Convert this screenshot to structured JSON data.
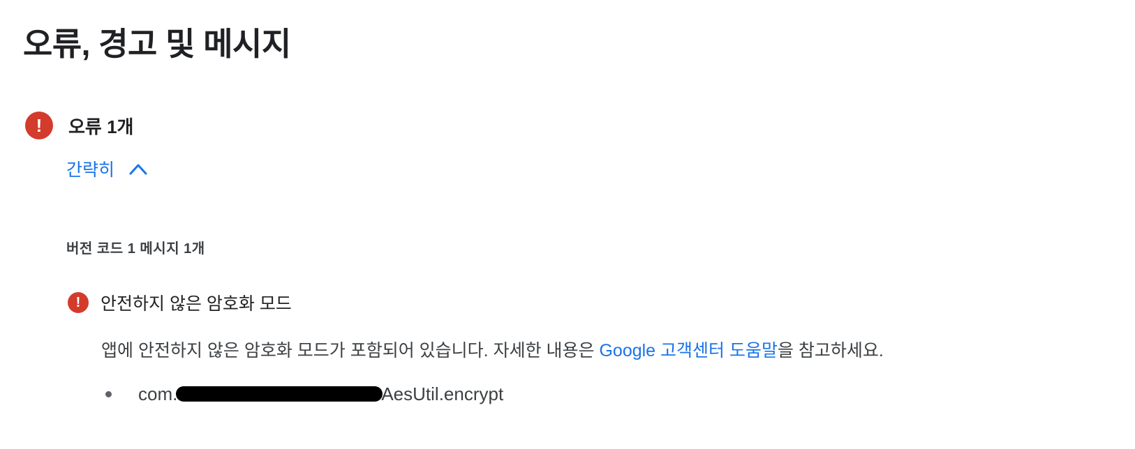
{
  "page": {
    "title": "오류, 경고 및 메시지"
  },
  "errors_section": {
    "count_label": "오류 1개",
    "icon": "error-exclamation-icon",
    "icon_glyph": "!",
    "toggle_label": "간략히",
    "toggle_icon": "chevron-up-icon",
    "version_heading": "버전 코드 1 메시지 1개"
  },
  "issue": {
    "icon": "error-exclamation-icon",
    "icon_glyph": "!",
    "title": "안전하지 않은 암호화 모드",
    "description_prefix": "앱에 안전하지 않은 암호화 모드가 포함되어 있습니다. 자세한 내용은 ",
    "help_link_label": "Google 고객센터 도움말",
    "description_suffix": "을 참고하세요.",
    "details": [
      {
        "path_prefix": "com.",
        "path_suffix": "AesUtil.encrypt"
      }
    ]
  },
  "colors": {
    "error_red": "#d33b2c",
    "link_blue": "#1a73e8",
    "text_primary": "#202124",
    "text_secondary": "#3c4043"
  }
}
